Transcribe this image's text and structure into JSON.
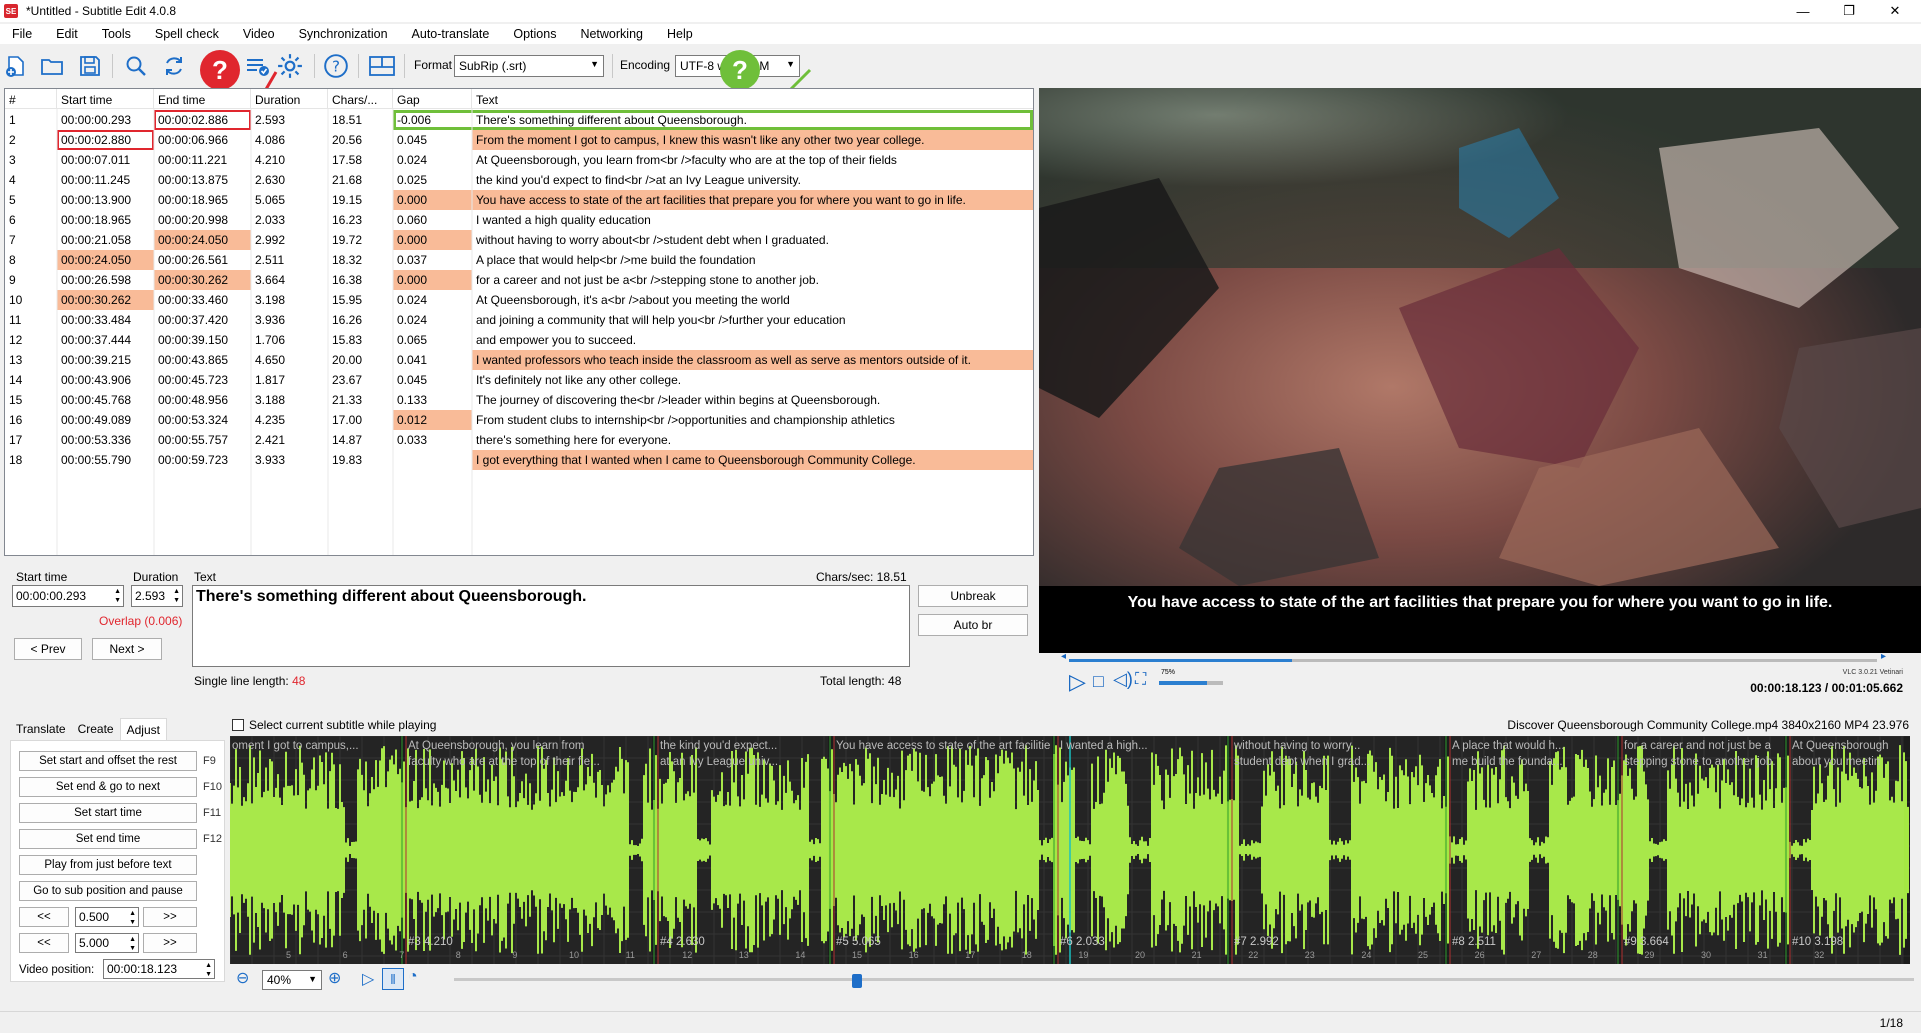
{
  "window": {
    "title": "*Untitled - Subtitle Edit 4.0.8",
    "app_icon_text": "SE",
    "minimize": "—",
    "maximize": "❐",
    "close": "✕"
  },
  "menu": [
    "File",
    "Edit",
    "Tools",
    "Spell check",
    "Video",
    "Synchronization",
    "Auto-translate",
    "Options",
    "Networking",
    "Help"
  ],
  "toolbar": {
    "format_label": "Format",
    "format_value": "SubRip (.srt)",
    "encoding_label": "Encoding",
    "encoding_value": "UTF-8 with BOM",
    "help_badge": "?"
  },
  "grid": {
    "columns": [
      "#",
      "Start time",
      "End time",
      "Duration",
      "Chars/...",
      "Gap",
      "Text"
    ],
    "rows": [
      {
        "n": "1",
        "start": "00:00:00.293",
        "end": "00:00:02.886",
        "dur": "2.593",
        "cps": "18.51",
        "gap": "-0.006",
        "text": "There's something different about Queensborough."
      },
      {
        "n": "2",
        "start": "00:00:02.880",
        "end": "00:00:06.966",
        "dur": "4.086",
        "cps": "20.56",
        "gap": "0.045",
        "text": "From the moment I got to campus, I knew this wasn't like any other two year college."
      },
      {
        "n": "3",
        "start": "00:00:07.011",
        "end": "00:00:11.221",
        "dur": "4.210",
        "cps": "17.58",
        "gap": "0.024",
        "text": "At Queensborough, you learn from<br />faculty who are at the top of their fields"
      },
      {
        "n": "4",
        "start": "00:00:11.245",
        "end": "00:00:13.875",
        "dur": "2.630",
        "cps": "21.68",
        "gap": "0.025",
        "text": "the kind you'd expect to find<br />at an Ivy League university."
      },
      {
        "n": "5",
        "start": "00:00:13.900",
        "end": "00:00:18.965",
        "dur": "5.065",
        "cps": "19.15",
        "gap": "0.000",
        "text": "You have access to state of the art facilities that prepare you for where you want to go in life."
      },
      {
        "n": "6",
        "start": "00:00:18.965",
        "end": "00:00:20.998",
        "dur": "2.033",
        "cps": "16.23",
        "gap": "0.060",
        "text": "I wanted a high quality education"
      },
      {
        "n": "7",
        "start": "00:00:21.058",
        "end": "00:00:24.050",
        "dur": "2.992",
        "cps": "19.72",
        "gap": "0.000",
        "text": "without having to worry about<br />student debt when I graduated."
      },
      {
        "n": "8",
        "start": "00:00:24.050",
        "end": "00:00:26.561",
        "dur": "2.511",
        "cps": "18.32",
        "gap": "0.037",
        "text": "A place that would help<br />me build the foundation"
      },
      {
        "n": "9",
        "start": "00:00:26.598",
        "end": "00:00:30.262",
        "dur": "3.664",
        "cps": "16.38",
        "gap": "0.000",
        "text": "for a career and not just be a<br />stepping stone to another job."
      },
      {
        "n": "10",
        "start": "00:00:30.262",
        "end": "00:00:33.460",
        "dur": "3.198",
        "cps": "15.95",
        "gap": "0.024",
        "text": "At Queensborough, it's a<br />about you meeting the world"
      },
      {
        "n": "11",
        "start": "00:00:33.484",
        "end": "00:00:37.420",
        "dur": "3.936",
        "cps": "16.26",
        "gap": "0.024",
        "text": "and joining a community that will help you<br />further your education"
      },
      {
        "n": "12",
        "start": "00:00:37.444",
        "end": "00:00:39.150",
        "dur": "1.706",
        "cps": "15.83",
        "gap": "0.065",
        "text": "and empower you to succeed."
      },
      {
        "n": "13",
        "start": "00:00:39.215",
        "end": "00:00:43.865",
        "dur": "4.650",
        "cps": "20.00",
        "gap": "0.041",
        "text": "I wanted professors who teach inside the classroom as well as serve as mentors outside of it."
      },
      {
        "n": "14",
        "start": "00:00:43.906",
        "end": "00:00:45.723",
        "dur": "1.817",
        "cps": "23.67",
        "gap": "0.045",
        "text": "It's definitely not like any other college."
      },
      {
        "n": "15",
        "start": "00:00:45.768",
        "end": "00:00:48.956",
        "dur": "3.188",
        "cps": "21.33",
        "gap": "0.133",
        "text": "The journey of discovering the<br />leader within begins at Queensborough."
      },
      {
        "n": "16",
        "start": "00:00:49.089",
        "end": "00:00:53.324",
        "dur": "4.235",
        "cps": "17.00",
        "gap": "0.012",
        "text": "From student clubs to internship<br />opportunities and championship athletics"
      },
      {
        "n": "17",
        "start": "00:00:53.336",
        "end": "00:00:55.757",
        "dur": "2.421",
        "cps": "14.87",
        "gap": "0.033",
        "text": "there's something here for everyone."
      },
      {
        "n": "18",
        "start": "00:00:55.790",
        "end": "00:00:59.723",
        "dur": "3.933",
        "cps": "19.83",
        "gap": "",
        "text": "I got everything that I wanted when I came to Queensborough Community College."
      }
    ]
  },
  "video": {
    "subtitle": "You have access to state of the art facilities that prepare you for where you want to go in life.",
    "time": "00:00:18.123 / 00:01:05.662",
    "vlc_label": "VLC 3.0.21 Vetinari",
    "volume_label": "75%",
    "volume_fraction": 0.75,
    "seek_fraction": 0.276
  },
  "edit": {
    "start_label": "Start time",
    "duration_label": "Duration",
    "text_label": "Text",
    "cps": "Chars/sec: 18.51",
    "start_value": "00:00:00.293",
    "duration_value": "2.593",
    "overlap": "Overlap (0.006)",
    "prev": "< Prev",
    "next": "Next >",
    "text": "There's something different about Queensborough.",
    "single_line_label": "Single line length: ",
    "single_line_value": "48",
    "total_length": "Total length: 48",
    "unbreak": "Unbreak",
    "auto_br": "Auto br"
  },
  "tabs": [
    "Translate",
    "Create",
    "Adjust"
  ],
  "adjust": {
    "buttons": [
      {
        "label": "Set start and offset the rest",
        "key": "F9"
      },
      {
        "label": "Set end & go to next",
        "key": "F10"
      },
      {
        "label": "Set start time",
        "key": "F11"
      },
      {
        "label": "Set end time",
        "key": "F12"
      },
      {
        "label": "Play from just before text",
        "key": ""
      },
      {
        "label": "Go to sub position and pause",
        "key": ""
      }
    ],
    "back": "<<",
    "fwd": ">>",
    "step1": "0.500",
    "step2": "5.000",
    "video_pos_label": "Video position:",
    "video_pos_value": "00:00:18.123"
  },
  "waveform": {
    "select_label": "Select current subtitle while playing",
    "file_info": "Discover Queensborough Community College.mp4 3840x2160 MP4 23.976",
    "zoom": "40%",
    "segments": [
      {
        "text1": "oment I got to campus,...",
        "text2": ""
      },
      {
        "text1": "At Queensborough, you learn from",
        "text2": "faculty who are at the top of their fie..."
      },
      {
        "text1": "the kind you'd expect...",
        "text2": "at an Ivy League univ..."
      },
      {
        "text1": "You have access to state of the art facilities t...",
        "text2": ""
      },
      {
        "text1": "I wanted a high...",
        "text2": ""
      },
      {
        "text1": "without having to worry...",
        "text2": "student debt when I grad..."
      },
      {
        "text1": "A place that would h...",
        "text2": "me build the founda..."
      },
      {
        "text1": "for a career and not just be a",
        "text2": "stepping stone to another job."
      },
      {
        "text1": "At Queensborough",
        "text2": "about you meetin"
      }
    ],
    "markers": [
      "#3  4.210",
      "#4  2.630",
      "#5  5.065",
      "#6  2.033",
      "#7  2.992",
      "#8  2.511",
      "#9  3.664",
      "#10  3.198"
    ],
    "ticks": [
      "5",
      "6",
      "7",
      "8",
      "9",
      "10",
      "11",
      "12",
      "13",
      "14",
      "15",
      "16",
      "17",
      "18",
      "19",
      "20",
      "21",
      "22",
      "23",
      "24",
      "25",
      "26",
      "27",
      "28",
      "29",
      "30",
      "31",
      "32"
    ]
  },
  "status": {
    "count": "1/18"
  },
  "colors": {
    "highlight": "#f9bb98",
    "error_box": "#e0262e",
    "annotation_green": "#6fbf3a",
    "wave": "#a5e843"
  }
}
